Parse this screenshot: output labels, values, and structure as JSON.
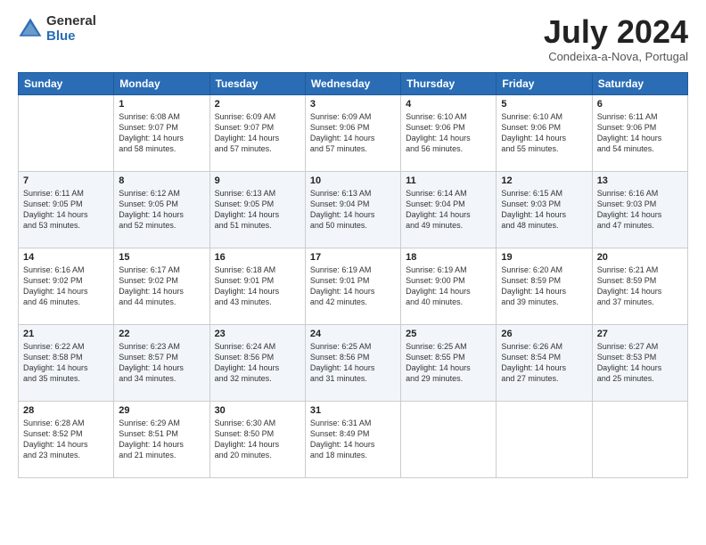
{
  "header": {
    "logo_general": "General",
    "logo_blue": "Blue",
    "month": "July 2024",
    "location": "Condeixa-a-Nova, Portugal"
  },
  "days_of_week": [
    "Sunday",
    "Monday",
    "Tuesday",
    "Wednesday",
    "Thursday",
    "Friday",
    "Saturday"
  ],
  "weeks": [
    [
      {
        "day": "",
        "sunrise": "",
        "sunset": "",
        "daylight": ""
      },
      {
        "day": "1",
        "sunrise": "Sunrise: 6:08 AM",
        "sunset": "Sunset: 9:07 PM",
        "daylight": "Daylight: 14 hours and 58 minutes."
      },
      {
        "day": "2",
        "sunrise": "Sunrise: 6:09 AM",
        "sunset": "Sunset: 9:07 PM",
        "daylight": "Daylight: 14 hours and 57 minutes."
      },
      {
        "day": "3",
        "sunrise": "Sunrise: 6:09 AM",
        "sunset": "Sunset: 9:06 PM",
        "daylight": "Daylight: 14 hours and 57 minutes."
      },
      {
        "day": "4",
        "sunrise": "Sunrise: 6:10 AM",
        "sunset": "Sunset: 9:06 PM",
        "daylight": "Daylight: 14 hours and 56 minutes."
      },
      {
        "day": "5",
        "sunrise": "Sunrise: 6:10 AM",
        "sunset": "Sunset: 9:06 PM",
        "daylight": "Daylight: 14 hours and 55 minutes."
      },
      {
        "day": "6",
        "sunrise": "Sunrise: 6:11 AM",
        "sunset": "Sunset: 9:06 PM",
        "daylight": "Daylight: 14 hours and 54 minutes."
      }
    ],
    [
      {
        "day": "7",
        "sunrise": "Sunrise: 6:11 AM",
        "sunset": "Sunset: 9:05 PM",
        "daylight": "Daylight: 14 hours and 53 minutes."
      },
      {
        "day": "8",
        "sunrise": "Sunrise: 6:12 AM",
        "sunset": "Sunset: 9:05 PM",
        "daylight": "Daylight: 14 hours and 52 minutes."
      },
      {
        "day": "9",
        "sunrise": "Sunrise: 6:13 AM",
        "sunset": "Sunset: 9:05 PM",
        "daylight": "Daylight: 14 hours and 51 minutes."
      },
      {
        "day": "10",
        "sunrise": "Sunrise: 6:13 AM",
        "sunset": "Sunset: 9:04 PM",
        "daylight": "Daylight: 14 hours and 50 minutes."
      },
      {
        "day": "11",
        "sunrise": "Sunrise: 6:14 AM",
        "sunset": "Sunset: 9:04 PM",
        "daylight": "Daylight: 14 hours and 49 minutes."
      },
      {
        "day": "12",
        "sunrise": "Sunrise: 6:15 AM",
        "sunset": "Sunset: 9:03 PM",
        "daylight": "Daylight: 14 hours and 48 minutes."
      },
      {
        "day": "13",
        "sunrise": "Sunrise: 6:16 AM",
        "sunset": "Sunset: 9:03 PM",
        "daylight": "Daylight: 14 hours and 47 minutes."
      }
    ],
    [
      {
        "day": "14",
        "sunrise": "Sunrise: 6:16 AM",
        "sunset": "Sunset: 9:02 PM",
        "daylight": "Daylight: 14 hours and 46 minutes."
      },
      {
        "day": "15",
        "sunrise": "Sunrise: 6:17 AM",
        "sunset": "Sunset: 9:02 PM",
        "daylight": "Daylight: 14 hours and 44 minutes."
      },
      {
        "day": "16",
        "sunrise": "Sunrise: 6:18 AM",
        "sunset": "Sunset: 9:01 PM",
        "daylight": "Daylight: 14 hours and 43 minutes."
      },
      {
        "day": "17",
        "sunrise": "Sunrise: 6:19 AM",
        "sunset": "Sunset: 9:01 PM",
        "daylight": "Daylight: 14 hours and 42 minutes."
      },
      {
        "day": "18",
        "sunrise": "Sunrise: 6:19 AM",
        "sunset": "Sunset: 9:00 PM",
        "daylight": "Daylight: 14 hours and 40 minutes."
      },
      {
        "day": "19",
        "sunrise": "Sunrise: 6:20 AM",
        "sunset": "Sunset: 8:59 PM",
        "daylight": "Daylight: 14 hours and 39 minutes."
      },
      {
        "day": "20",
        "sunrise": "Sunrise: 6:21 AM",
        "sunset": "Sunset: 8:59 PM",
        "daylight": "Daylight: 14 hours and 37 minutes."
      }
    ],
    [
      {
        "day": "21",
        "sunrise": "Sunrise: 6:22 AM",
        "sunset": "Sunset: 8:58 PM",
        "daylight": "Daylight: 14 hours and 35 minutes."
      },
      {
        "day": "22",
        "sunrise": "Sunrise: 6:23 AM",
        "sunset": "Sunset: 8:57 PM",
        "daylight": "Daylight: 14 hours and 34 minutes."
      },
      {
        "day": "23",
        "sunrise": "Sunrise: 6:24 AM",
        "sunset": "Sunset: 8:56 PM",
        "daylight": "Daylight: 14 hours and 32 minutes."
      },
      {
        "day": "24",
        "sunrise": "Sunrise: 6:25 AM",
        "sunset": "Sunset: 8:56 PM",
        "daylight": "Daylight: 14 hours and 31 minutes."
      },
      {
        "day": "25",
        "sunrise": "Sunrise: 6:25 AM",
        "sunset": "Sunset: 8:55 PM",
        "daylight": "Daylight: 14 hours and 29 minutes."
      },
      {
        "day": "26",
        "sunrise": "Sunrise: 6:26 AM",
        "sunset": "Sunset: 8:54 PM",
        "daylight": "Daylight: 14 hours and 27 minutes."
      },
      {
        "day": "27",
        "sunrise": "Sunrise: 6:27 AM",
        "sunset": "Sunset: 8:53 PM",
        "daylight": "Daylight: 14 hours and 25 minutes."
      }
    ],
    [
      {
        "day": "28",
        "sunrise": "Sunrise: 6:28 AM",
        "sunset": "Sunset: 8:52 PM",
        "daylight": "Daylight: 14 hours and 23 minutes."
      },
      {
        "day": "29",
        "sunrise": "Sunrise: 6:29 AM",
        "sunset": "Sunset: 8:51 PM",
        "daylight": "Daylight: 14 hours and 21 minutes."
      },
      {
        "day": "30",
        "sunrise": "Sunrise: 6:30 AM",
        "sunset": "Sunset: 8:50 PM",
        "daylight": "Daylight: 14 hours and 20 minutes."
      },
      {
        "day": "31",
        "sunrise": "Sunrise: 6:31 AM",
        "sunset": "Sunset: 8:49 PM",
        "daylight": "Daylight: 14 hours and 18 minutes."
      },
      {
        "day": "",
        "sunrise": "",
        "sunset": "",
        "daylight": ""
      },
      {
        "day": "",
        "sunrise": "",
        "sunset": "",
        "daylight": ""
      },
      {
        "day": "",
        "sunrise": "",
        "sunset": "",
        "daylight": ""
      }
    ]
  ]
}
